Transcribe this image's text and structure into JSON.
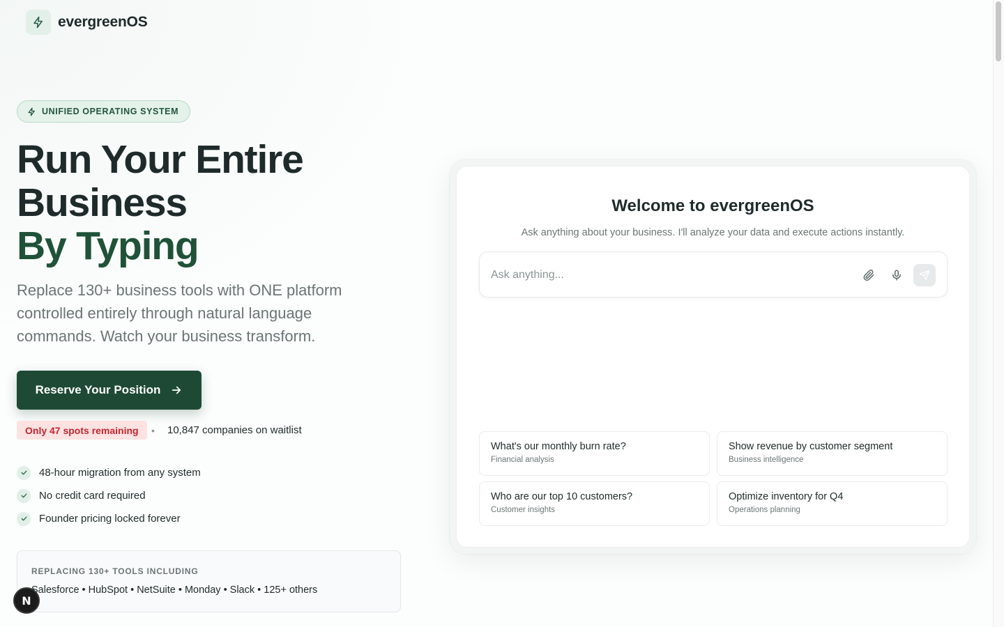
{
  "header": {
    "brand": "evergreenOS",
    "logo_icon": "bolt-icon"
  },
  "hero": {
    "badge": "UNIFIED OPERATING SYSTEM",
    "headline_line1": "Run Your Entire",
    "headline_line2": "Business",
    "headline_accent": "By Typing",
    "subhead": "Replace 130+ business tools with ONE platform controlled entirely through natural language commands. Watch your business transform.",
    "cta_label": "Reserve Your Position",
    "spots_label": "Only 47 spots remaining",
    "separator": "•",
    "waitlist_label": "10,847 companies on waitlist",
    "features": [
      "48-hour migration from any system",
      "No credit card required",
      "Founder pricing locked forever"
    ],
    "replacing_title": "REPLACING 130+ TOOLS INCLUDING",
    "replacing_list": "Salesforce • HubSpot • NetSuite • Monday • Slack • 125+ others"
  },
  "assistant": {
    "title": "Welcome to evergreenOS",
    "subtitle": "Ask anything about your business. I'll analyze your data and execute actions instantly.",
    "input_placeholder": "Ask anything...",
    "suggestions": [
      {
        "question": "What's our monthly burn rate?",
        "category": "Financial analysis"
      },
      {
        "question": "Show revenue by customer segment",
        "category": "Business intelligence"
      },
      {
        "question": "Who are our top 10 customers?",
        "category": "Customer insights"
      },
      {
        "question": "Optimize inventory for Q4",
        "category": "Operations planning"
      }
    ]
  },
  "dev_badge": "N",
  "colors": {
    "brand_dark": "#1e4a35",
    "accent_green": "#1f5238",
    "badge_bg": "#e4f2ea",
    "alert_bg": "#fde2e2",
    "alert_text": "#c0262d"
  }
}
